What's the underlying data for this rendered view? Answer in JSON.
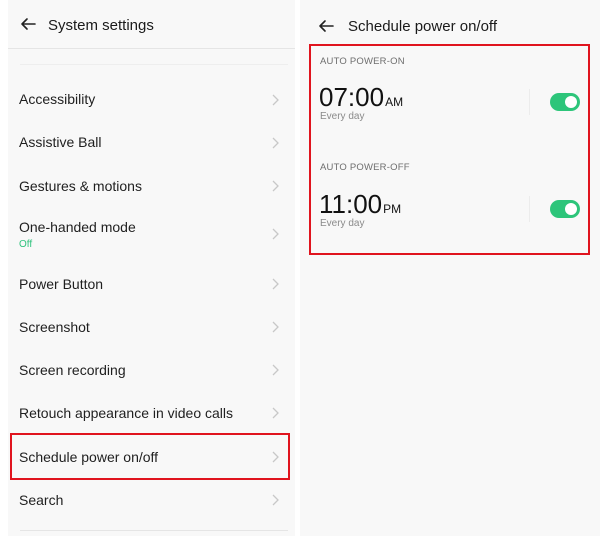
{
  "left_screen": {
    "title": "System settings",
    "back_icon": "arrow-left-icon",
    "items": [
      {
        "label": "Accessibility"
      },
      {
        "label": "Assistive Ball"
      },
      {
        "label": "Gestures & motions"
      },
      {
        "label": "One-handed mode",
        "status": "Off"
      },
      {
        "label": "Power Button"
      },
      {
        "label": "Screenshot"
      },
      {
        "label": "Screen recording"
      },
      {
        "label": "Retouch appearance in video calls"
      },
      {
        "label": "Schedule power on/off",
        "highlighted": true
      },
      {
        "label": "Search"
      }
    ]
  },
  "right_screen": {
    "title": "Schedule power on/off",
    "back_icon": "arrow-left-icon",
    "auto_power_on": {
      "section_label": "AUTO POWER-ON",
      "time": "07:00",
      "meridiem": "AM",
      "repeat": "Every day",
      "enabled": true
    },
    "auto_power_off": {
      "section_label": "AUTO POWER-OFF",
      "time": "11:00",
      "meridiem": "PM",
      "repeat": "Every day",
      "enabled": true
    }
  },
  "colors": {
    "accent_green": "#2dc57a",
    "highlight_red": "#e0141e",
    "background": "#f8f8f8"
  }
}
